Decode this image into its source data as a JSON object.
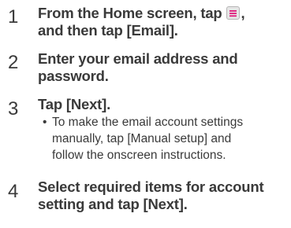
{
  "steps": [
    {
      "number": "1",
      "line1_before_icon": "From the Home screen, tap ",
      "icon": "menu-key-icon",
      "line1_after_icon": ",",
      "line2": "and then tap [Email]."
    },
    {
      "number": "2",
      "line1": "Enter your email address and",
      "line2": "password."
    },
    {
      "number": "3",
      "line1": "Tap [Next].",
      "note_bullet": "•",
      "note_line1": "To make the email account settings",
      "note_line2": "manually, tap [Manual setup] and",
      "note_line3": "follow the onscreen instructions."
    },
    {
      "number": "4",
      "line1": "Select required items for account",
      "line2": "setting and tap [Next]."
    }
  ],
  "colors": {
    "text": "#3a3a3a",
    "icon_fill": "#e6e6e6",
    "icon_border": "#b5b5b5",
    "icon_accent": "#e0187a"
  }
}
